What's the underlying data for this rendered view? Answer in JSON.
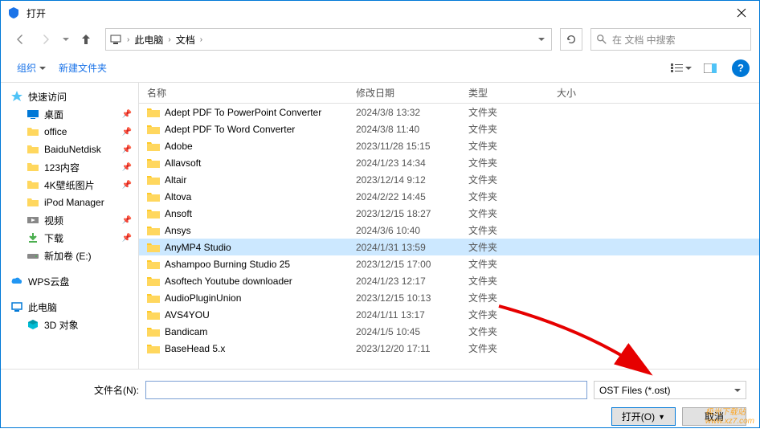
{
  "window": {
    "title": "打开"
  },
  "nav": {
    "breadcrumb": [
      "此电脑",
      "文档"
    ],
    "search_placeholder": "在 文档 中搜索"
  },
  "toolbar": {
    "organize": "组织",
    "new_folder": "新建文件夹"
  },
  "sidebar": {
    "quick_access": "快速访问",
    "desktop": "桌面",
    "office": "office",
    "baidu": "BaiduNetdisk",
    "content123": "123内容",
    "wallpaper": "4K壁纸图片",
    "ipod": "iPod Manager",
    "video": "视频",
    "downloads": "下载",
    "new_volume": "新加卷 (E:)",
    "wps": "WPS云盘",
    "this_pc": "此电脑",
    "objects3d": "3D 对象"
  },
  "columns": {
    "name": "名称",
    "date": "修改日期",
    "type": "类型",
    "size": "大小"
  },
  "files": [
    {
      "name": "Adept PDF To PowerPoint Converter",
      "date": "2024/3/8 13:32",
      "type": "文件夹",
      "selected": false
    },
    {
      "name": "Adept PDF To Word Converter",
      "date": "2024/3/8 11:40",
      "type": "文件夹",
      "selected": false
    },
    {
      "name": "Adobe",
      "date": "2023/11/28 15:15",
      "type": "文件夹",
      "selected": false
    },
    {
      "name": "Allavsoft",
      "date": "2024/1/23 14:34",
      "type": "文件夹",
      "selected": false
    },
    {
      "name": "Altair",
      "date": "2023/12/14 9:12",
      "type": "文件夹",
      "selected": false
    },
    {
      "name": "Altova",
      "date": "2024/2/22 14:45",
      "type": "文件夹",
      "selected": false
    },
    {
      "name": "Ansoft",
      "date": "2023/12/15 18:27",
      "type": "文件夹",
      "selected": false
    },
    {
      "name": "Ansys",
      "date": "2024/3/6 10:40",
      "type": "文件夹",
      "selected": false
    },
    {
      "name": "AnyMP4 Studio",
      "date": "2024/1/31 13:59",
      "type": "文件夹",
      "selected": true
    },
    {
      "name": "Ashampoo Burning Studio 25",
      "date": "2023/12/15 17:00",
      "type": "文件夹",
      "selected": false
    },
    {
      "name": "Asoftech Youtube downloader",
      "date": "2024/1/23 12:17",
      "type": "文件夹",
      "selected": false
    },
    {
      "name": "AudioPluginUnion",
      "date": "2023/12/15 10:13",
      "type": "文件夹",
      "selected": false
    },
    {
      "name": "AVS4YOU",
      "date": "2024/1/11 13:17",
      "type": "文件夹",
      "selected": false
    },
    {
      "name": "Bandicam",
      "date": "2024/1/5 10:45",
      "type": "文件夹",
      "selected": false
    },
    {
      "name": "BaseHead 5.x",
      "date": "2023/12/20 17:11",
      "type": "文件夹",
      "selected": false
    }
  ],
  "bottom": {
    "filename_label": "文件名(N):",
    "filename_value": "",
    "filetype": "OST Files (*.ost)",
    "open_btn": "打开(O)",
    "cancel_btn": "取消"
  },
  "watermark": "极光下载站\nwww.xz7.com"
}
